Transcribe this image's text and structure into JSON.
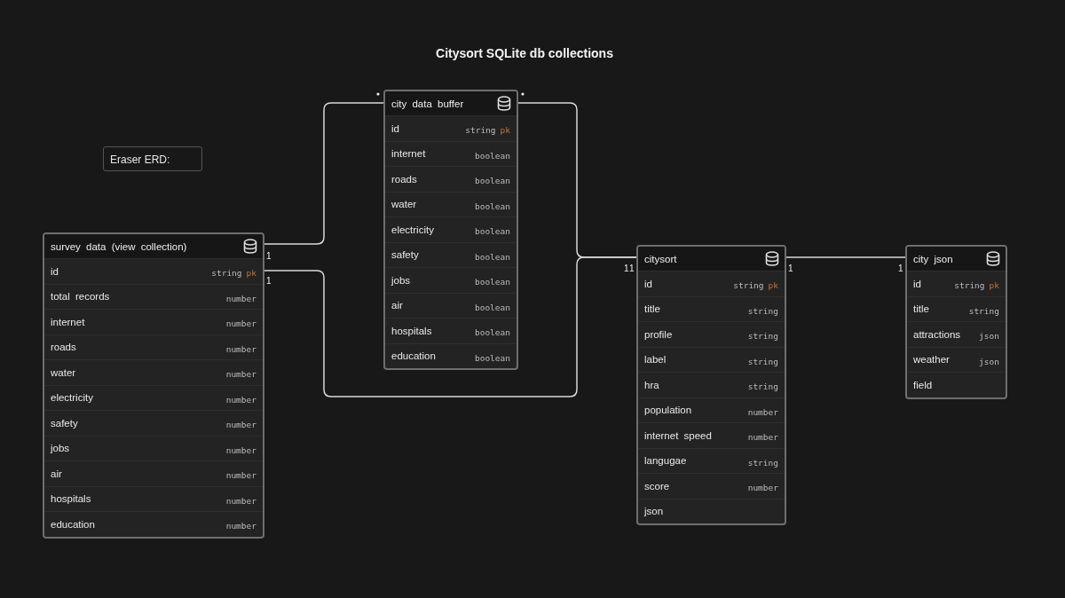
{
  "title": "Citysort SQLite db collections",
  "note": "Eraser ERD:",
  "tables": [
    {
      "name": "survey data (view collection)",
      "fields": [
        {
          "name": "id",
          "type": "string",
          "key": "pk"
        },
        {
          "name": "total records",
          "type": "number"
        },
        {
          "name": "internet",
          "type": "number"
        },
        {
          "name": "roads",
          "type": "number"
        },
        {
          "name": "water",
          "type": "number"
        },
        {
          "name": "electricity",
          "type": "number"
        },
        {
          "name": "safety",
          "type": "number"
        },
        {
          "name": "jobs",
          "type": "number"
        },
        {
          "name": "air",
          "type": "number"
        },
        {
          "name": "hospitals",
          "type": "number"
        },
        {
          "name": "education",
          "type": "number"
        }
      ]
    },
    {
      "name": "city data buffer",
      "fields": [
        {
          "name": "id",
          "type": "string",
          "key": "pk"
        },
        {
          "name": "internet",
          "type": "boolean"
        },
        {
          "name": "roads",
          "type": "boolean"
        },
        {
          "name": "water",
          "type": "boolean"
        },
        {
          "name": "electricity",
          "type": "boolean"
        },
        {
          "name": "safety",
          "type": "boolean"
        },
        {
          "name": "jobs",
          "type": "boolean"
        },
        {
          "name": "air",
          "type": "boolean"
        },
        {
          "name": "hospitals",
          "type": "boolean"
        },
        {
          "name": "education",
          "type": "boolean"
        }
      ]
    },
    {
      "name": "citysort",
      "fields": [
        {
          "name": "id",
          "type": "string",
          "key": "pk"
        },
        {
          "name": "title",
          "type": "string"
        },
        {
          "name": "profile",
          "type": "string"
        },
        {
          "name": "label",
          "type": "string"
        },
        {
          "name": "hra",
          "type": "string"
        },
        {
          "name": "population",
          "type": "number"
        },
        {
          "name": "internet speed",
          "type": "number"
        },
        {
          "name": "langugae",
          "type": "string"
        },
        {
          "name": "score",
          "type": "number"
        },
        {
          "name": "json"
        }
      ]
    },
    {
      "name": "city json",
      "fields": [
        {
          "name": "id",
          "type": "string",
          "key": "pk"
        },
        {
          "name": "title",
          "type": "string"
        },
        {
          "name": "attractions",
          "type": "json"
        },
        {
          "name": "weather",
          "type": "json"
        },
        {
          "name": "field"
        }
      ]
    }
  ],
  "relations": [
    {
      "start_label": "1"
    },
    {
      "start_label": "1",
      "end_label": "1"
    },
    {
      "end_label": "1"
    },
    {
      "start_label": "1",
      "end_label": "1"
    }
  ]
}
